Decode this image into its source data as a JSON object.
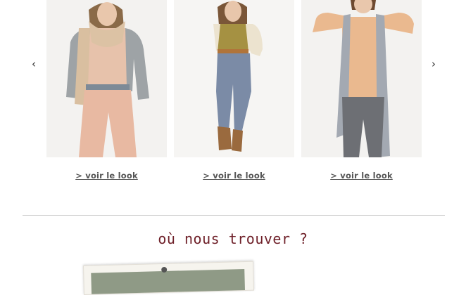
{
  "carousel": {
    "prev_icon": "chevron-left-icon",
    "prev_glyph": "‹",
    "next_icon": "chevron-right-icon",
    "next_glyph": "›",
    "looks": [
      {
        "link_label": "> voir le look"
      },
      {
        "link_label": "> voir le look"
      },
      {
        "link_label": "> voir le look"
      }
    ]
  },
  "store_section": {
    "title": "où nous trouver ?"
  },
  "colors": {
    "title": "#6e1f28",
    "link": "#555555",
    "divider": "#c9c9c9",
    "photo_bg": "#f3f2f0"
  }
}
